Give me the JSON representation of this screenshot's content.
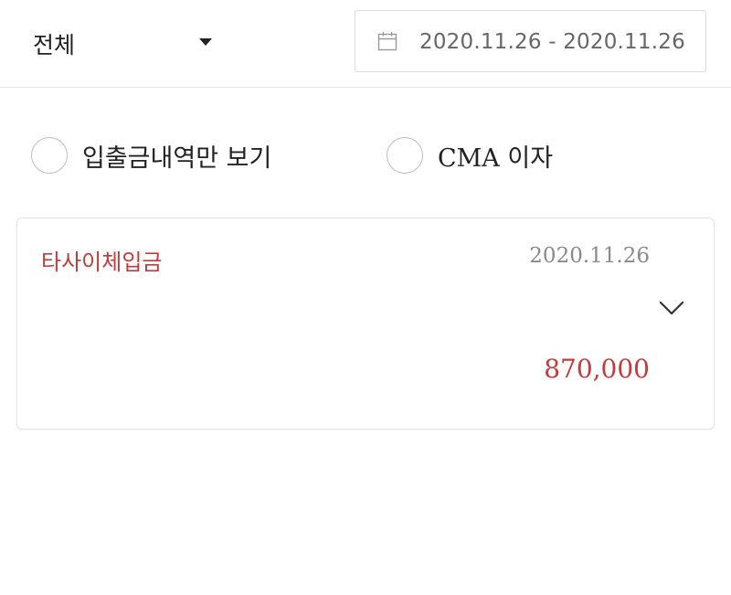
{
  "filter_bar": {
    "type_select": {
      "value": "전체",
      "icon": "caret-down-icon"
    },
    "date_range": {
      "value": "2020.11.26 - 2020.11.26",
      "icon": "calendar-icon"
    }
  },
  "options": [
    {
      "label": "입출금내역만 보기",
      "checked": false
    },
    {
      "label": "CMA 이자",
      "checked": false
    }
  ],
  "transactions": [
    {
      "title": "타사이체입금",
      "date": "2020.11.26",
      "amount": "870,000",
      "expand_icon": "chevron-down-icon"
    }
  ],
  "colors": {
    "deposit_red": "#c33b3b",
    "muted_gray": "#8a8a8a",
    "border": "#e3e3e3"
  }
}
